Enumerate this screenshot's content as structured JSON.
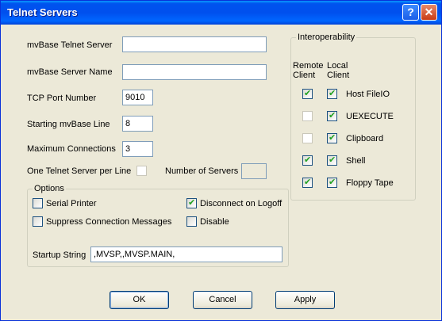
{
  "window": {
    "title": "Telnet Servers",
    "help_glyph": "?",
    "close_glyph": "✕"
  },
  "fields": {
    "telnet_server_label": "mvBase Telnet Server",
    "telnet_server_value": "",
    "server_name_label": "mvBase Server Name",
    "server_name_value": "",
    "port_label": "TCP Port Number",
    "port_value": "9010",
    "starting_line_label": "Starting mvBase Line",
    "starting_line_value": "8",
    "max_conn_label": "Maximum Connections",
    "max_conn_value": "3",
    "one_per_line_label": "One Telnet Server per Line",
    "one_per_line_checked": false,
    "num_servers_label": "Number of Servers",
    "num_servers_value": ""
  },
  "options": {
    "group_label": "Options",
    "serial_printer": {
      "label": "Serial Printer",
      "checked": false
    },
    "suppress_msgs": {
      "label": "Suppress Connection Messages",
      "checked": false
    },
    "disconnect_logoff": {
      "label": "Disconnect on Logoff",
      "checked": true
    },
    "disable": {
      "label": "Disable",
      "checked": false
    },
    "startup_label": "Startup String",
    "startup_value": ",MVSP,,MVSP.MAIN,"
  },
  "interop": {
    "group_label": "Interoperability",
    "col_remote": "Remote\nClient",
    "col_local": "Local\nClient",
    "rows": [
      {
        "label": "Host FileIO",
        "remote": true,
        "remote_enabled": true,
        "local": true
      },
      {
        "label": "UEXECUTE",
        "remote": false,
        "remote_enabled": false,
        "local": true
      },
      {
        "label": "Clipboard",
        "remote": false,
        "remote_enabled": false,
        "local": true
      },
      {
        "label": "Shell",
        "remote": true,
        "remote_enabled": true,
        "local": true
      },
      {
        "label": "Floppy Tape",
        "remote": true,
        "remote_enabled": true,
        "local": true
      }
    ]
  },
  "buttons": {
    "ok": "OK",
    "cancel": "Cancel",
    "apply": "Apply"
  }
}
